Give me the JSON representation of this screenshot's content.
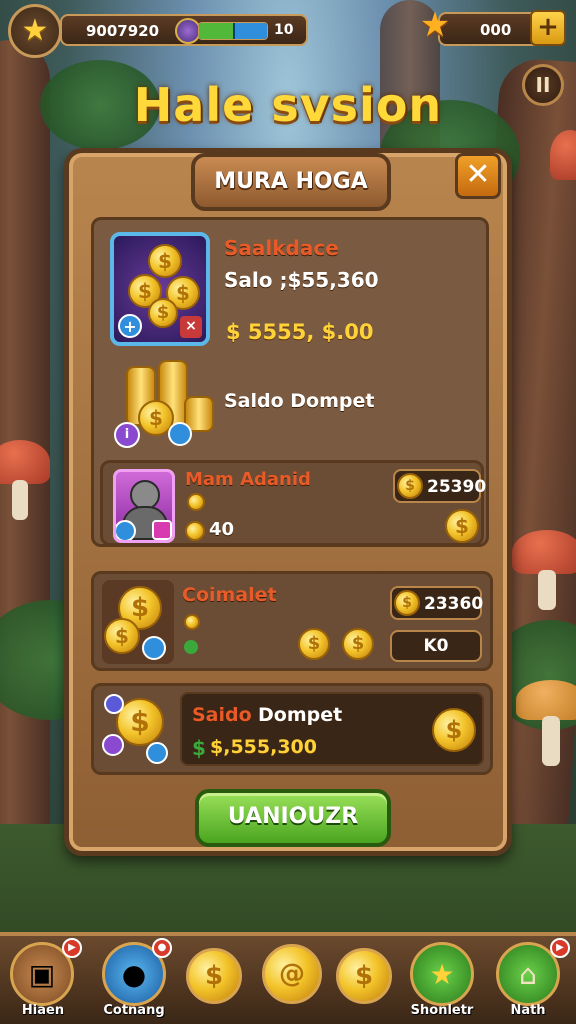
{
  "top_bar": {
    "score": "9007920",
    "energy_value": "10",
    "energy_fraction": 0.55,
    "coins": "000",
    "plus_label": "+",
    "pause_label": "II"
  },
  "title": "Hale svsion",
  "panel": {
    "header": "MURA HOGA",
    "close_label": "✕",
    "balance_label": "Saalkdace",
    "balance_value": "Salo ;$55,360",
    "balance_amount": "$ 5555, $.00",
    "dompet_label": "Saldo Dompet",
    "item1": {
      "name": "Mam Adanid",
      "count": "40",
      "price": "25390"
    },
    "item2": {
      "name": "Coimalet",
      "price": "23360",
      "chip_label": "K0"
    },
    "wallet": {
      "label_orange": "Saido",
      "label_white": "Dompet",
      "amount": "$,555,300"
    },
    "action_button": "UANIOUZR"
  },
  "bottom_nav": [
    {
      "label": "Hiaen",
      "icon": "box-icon"
    },
    {
      "label": "Cotnang",
      "icon": "orb-icon"
    },
    {
      "label": "",
      "icon": "coin-icon"
    },
    {
      "label": "",
      "icon": "swirl-coin-icon"
    },
    {
      "label": "",
      "icon": "coin-icon"
    },
    {
      "label": "Shonletr",
      "icon": "star-icon"
    },
    {
      "label": "Nath",
      "icon": "house-icon"
    }
  ],
  "colors": {
    "accent_gold": "#ffd23a",
    "panel_wood": "#8e5f34",
    "button_green": "#4aa51e",
    "label_orange": "#e85a28"
  }
}
